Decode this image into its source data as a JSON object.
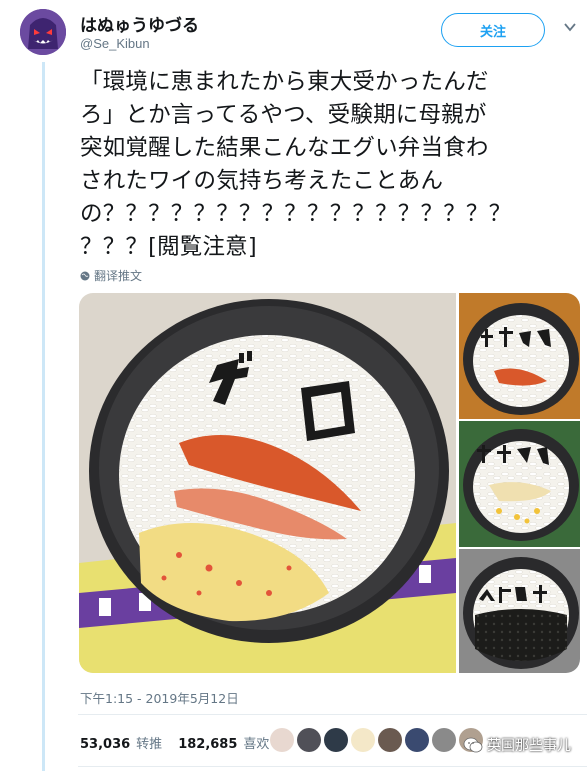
{
  "author": {
    "name": "はぬゅうゆづる",
    "handle": "@Se_Kibun",
    "avatar_icon": "ghost-avatar-icon",
    "avatar_color": "#5a3a8c"
  },
  "follow_label": "关注",
  "tweet": {
    "lines": [
      "「環境に恵まれたから東大受かったんだ",
      "ろ」とか言ってるやつ、受験期に母親が",
      "突如覚醒した結果こんなエグい弁当食わ",
      "されたワイの気持ち考えたことあん",
      "の？？？？？？？？？？？？？？？？？？",
      "？？？[閲覧注意]"
    ]
  },
  "translate_label": "翻译推文",
  "media": {
    "main_caption": "ゲロ",
    "side_captions": [
      "チンカス",
      "チナクジ",
      "ヘドロ味"
    ]
  },
  "timestamp": "下午1:15 - 2019年5月12日",
  "stats": {
    "retweets": "53,036",
    "retweets_label": "转推",
    "likes": "182,685",
    "likes_label": "喜欢"
  },
  "watermark": "英国那些事儿",
  "colors": {
    "accent": "#1da1f2",
    "thread_line": "#cde7f7",
    "muted": "#657786"
  }
}
